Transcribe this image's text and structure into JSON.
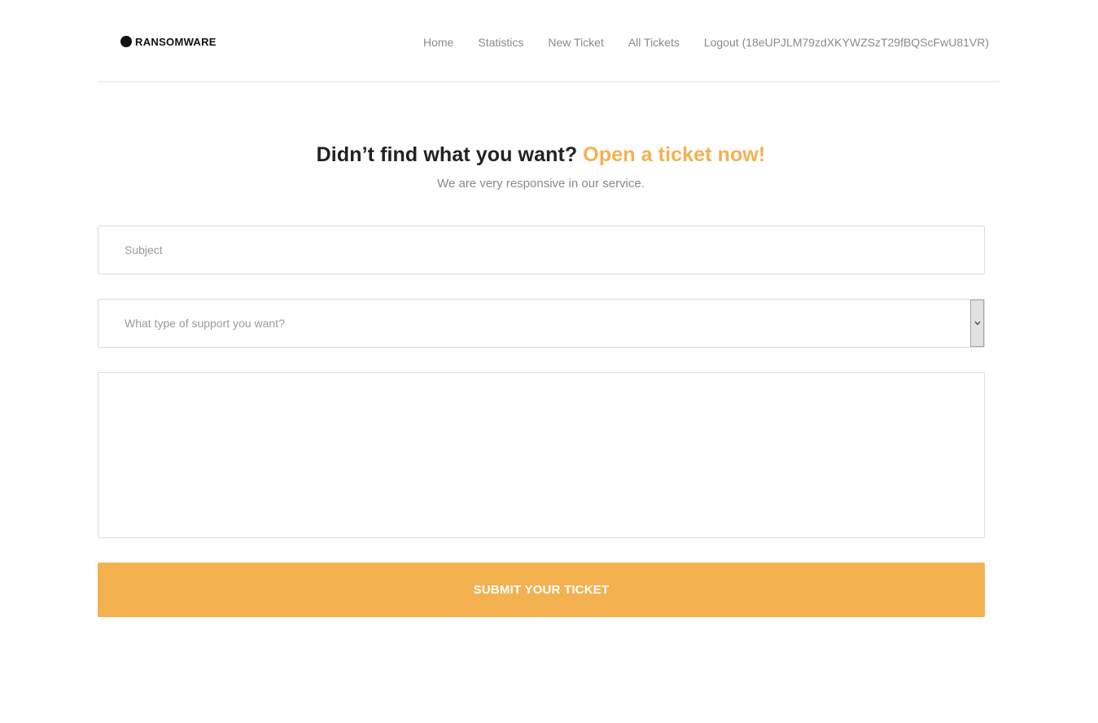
{
  "brand": {
    "logo_text": "RANSOMWARE",
    "accent_color": "#f3b150"
  },
  "nav": {
    "items": [
      {
        "label": "Home"
      },
      {
        "label": "Statistics"
      },
      {
        "label": "New Ticket"
      },
      {
        "label": "All Tickets"
      },
      {
        "label": "Logout (18eUPJLM79zdXKYWZSzT29fBQScFwU81VR)"
      }
    ]
  },
  "hero": {
    "title": "Didn’t find what you want?",
    "title_accent": "Open a ticket now!",
    "subtitle": "We are very responsive in our service."
  },
  "form": {
    "subject_placeholder": "Subject",
    "subject_value": "",
    "support_type_selected": "What type of support you want?",
    "message_value": "",
    "submit_label": "SUBMIT YOUR TICKET"
  }
}
